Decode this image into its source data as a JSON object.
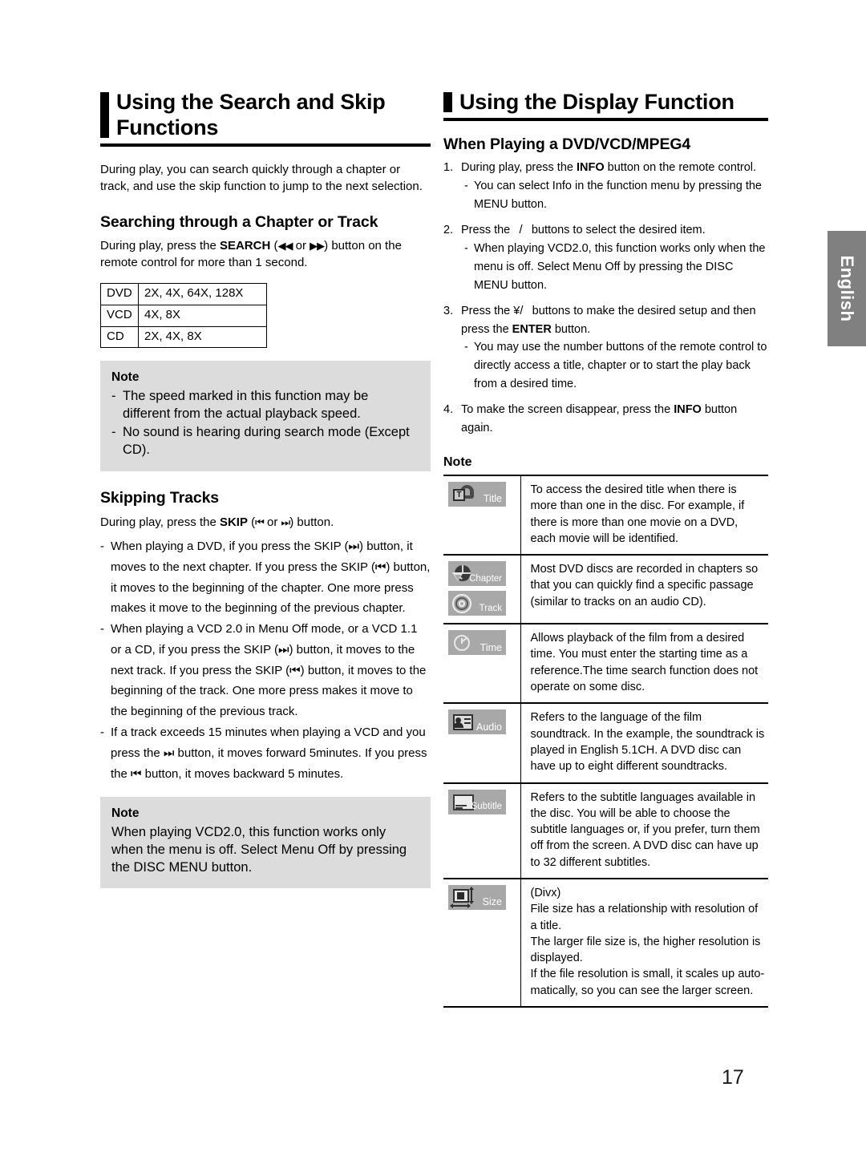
{
  "page": {
    "number": "17",
    "language_tab": "English"
  },
  "left": {
    "heading": "Using the Search and Skip Functions",
    "intro": "During play, you can search quickly through a chapter or track, and use the skip function to jump to the next selection.",
    "section1": {
      "heading": "Searching through a Chapter or Track",
      "paragraph_pre": "During play, press the ",
      "paragraph_bold": "SEARCH",
      "paragraph_mid": " (",
      "icon_rew": "◀◀",
      "paragraph_or": " or ",
      "icon_ff": "▶▶",
      "paragraph_post": ") button on the remote control for more than 1 second."
    },
    "speed_table": {
      "rows": [
        {
          "media": "DVD",
          "speeds": "2X, 4X, 64X, 128X"
        },
        {
          "media": "VCD",
          "speeds": "4X, 8X"
        },
        {
          "media": "CD",
          "speeds": "2X, 4X, 8X"
        }
      ]
    },
    "note1": {
      "title": "Note",
      "items": [
        "The speed marked in this function may be different from the actual playback speed.",
        "No sound is hearing during search mode (Except CD)."
      ]
    },
    "section2": {
      "heading": "Skipping Tracks",
      "lead_pre": "During play, press the ",
      "lead_bold": "SKIP",
      "lead_mid": " (",
      "icon_prev": "⏮",
      "lead_or": " or ",
      "icon_next": "⏭",
      "lead_post": ") button.",
      "bullets": [
        "When playing a DVD, if you press the SKIP (⏭) button, it moves to the next chapter. If you press the SKIP (⏮) button, it moves to the beginning of the chapter. One more press makes it move to the beginning of the previous chapter.",
        "When playing a VCD 2.0 in Menu Off mode, or a VCD 1.1 or a CD, if you press the SKIP (⏭) button, it moves to the next track. If you press the SKIP (⏮) button, it moves to the beginning of the track. One more press makes it move to the beginning of the previous track.",
        "If a track exceeds 15 minutes when playing a VCD and you press the ⏭ button, it moves forward 5minutes. If you press the ⏮ button, it moves backward 5 minutes."
      ]
    },
    "note2": {
      "title": "Note",
      "text": "When playing VCD2.0, this function works only when the menu is off. Select Menu Off by pressing the DISC MENU button."
    }
  },
  "right": {
    "heading": "Using the Display Function",
    "subheading": "When Playing a DVD/VCD/MPEG4",
    "steps": [
      {
        "number": "1.",
        "text_pre": "During play, press the ",
        "text_bold": "INFO",
        "text_post": " button on the remote control.",
        "sub": [
          "You can select Info in the function menu by pressing the MENU button."
        ]
      },
      {
        "number": "2.",
        "text_pre": "Press the ",
        "text_bold": "",
        "text_post": " /  buttons to select the desired item.",
        "sub": [
          "When playing VCD2.0, this function works only when the menu is off. Select Menu Off by pressing the DISC MENU button."
        ]
      },
      {
        "number": "3.",
        "text_pre": "Press the ¥/  buttons to make the desired setup and then press the ",
        "text_bold": "ENTER",
        "text_post": " button.",
        "sub": [
          "You may use the number buttons of the remote control to directly access a title, chapter or to start the play back from a desired time."
        ]
      },
      {
        "number": "4.",
        "text_pre": "To make the screen disappear, press the ",
        "text_bold": "INFO",
        "text_post": " button again.",
        "sub": []
      }
    ],
    "note_title": "Note",
    "icon_table": [
      {
        "icons": [
          {
            "name": "title-icon",
            "label": "Title"
          }
        ],
        "text": "To access the desired title when there is more than one in the disc. For example, if there is more than one movie on a DVD, each movie will be identified."
      },
      {
        "icons": [
          {
            "name": "chapter-icon",
            "label": "Chapter"
          },
          {
            "name": "track-icon",
            "label": "Track"
          }
        ],
        "text": "Most DVD discs are recorded in chapters so that you can quickly find a specific passage (similar to tracks on an audio CD)."
      },
      {
        "icons": [
          {
            "name": "time-icon",
            "label": "Time"
          }
        ],
        "text": "Allows playback of the film from a desired time. You must enter the starting time as a reference.The time search function does not operate on some disc."
      },
      {
        "icons": [
          {
            "name": "audio-icon",
            "label": "Audio"
          }
        ],
        "text": "Refers to the language of the film soundtrack. In the example, the soundtrack is played in English 5.1CH. A DVD disc can have up to eight different soundtracks."
      },
      {
        "icons": [
          {
            "name": "subtitle-icon",
            "label": "Subtitle"
          }
        ],
        "text": "Refers to the subtitle languages available in the disc. You will be able to choose the subtitle languages or, if you prefer, turn them off from the screen. A DVD disc can have up to 32 different subtitles."
      },
      {
        "icons": [
          {
            "name": "size-icon",
            "label": "Size"
          }
        ],
        "text_lines": [
          "(Divx)",
          "File size has a relationship with resolution of a title.",
          "The larger file size is, the higher resolution is displayed.",
          "If the file resolution is small, it scales up auto-matically, so you can see the larger screen."
        ]
      }
    ]
  }
}
